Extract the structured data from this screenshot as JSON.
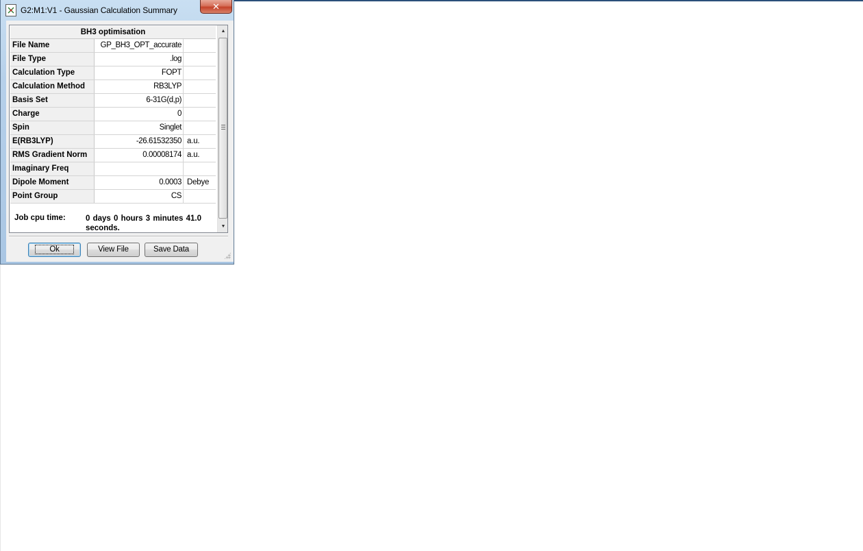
{
  "window": {
    "title": "G2:M1:V1 - Gaussian Calculation Summary",
    "close_label": "✕"
  },
  "summary": {
    "heading": "BH3 optimisation",
    "rows": [
      {
        "label": "File Name",
        "value": "GP_BH3_OPT_accurate",
        "unit": ""
      },
      {
        "label": "File Type",
        "value": ".log",
        "unit": ""
      },
      {
        "label": "Calculation Type",
        "value": "FOPT",
        "unit": ""
      },
      {
        "label": "Calculation Method",
        "value": "RB3LYP",
        "unit": ""
      },
      {
        "label": "Basis Set",
        "value": "6-31G(d,p)",
        "unit": ""
      },
      {
        "label": "Charge",
        "value": "0",
        "unit": ""
      },
      {
        "label": "Spin",
        "value": "Singlet",
        "unit": ""
      },
      {
        "label": "E(RB3LYP)",
        "value": "-26.61532350",
        "unit": "a.u."
      },
      {
        "label": "RMS Gradient Norm",
        "value": "0.00008174",
        "unit": "a.u."
      },
      {
        "label": "Imaginary Freq",
        "value": "",
        "unit": ""
      },
      {
        "label": "Dipole Moment",
        "value": "0.0003",
        "unit": "Debye"
      },
      {
        "label": "Point Group",
        "value": "CS",
        "unit": ""
      }
    ],
    "cpu_label": "Job cpu time:",
    "cpu_value": "0 days  0 hours  3 minutes 41.0 seconds."
  },
  "buttons": {
    "ok": "Ok",
    "view_file": "View File",
    "save_data": "Save Data"
  },
  "icons": {
    "title": "gaussview-window-icon",
    "scroll_up": "scroll-up-arrow-icon",
    "scroll_down": "scroll-down-arrow-icon"
  }
}
